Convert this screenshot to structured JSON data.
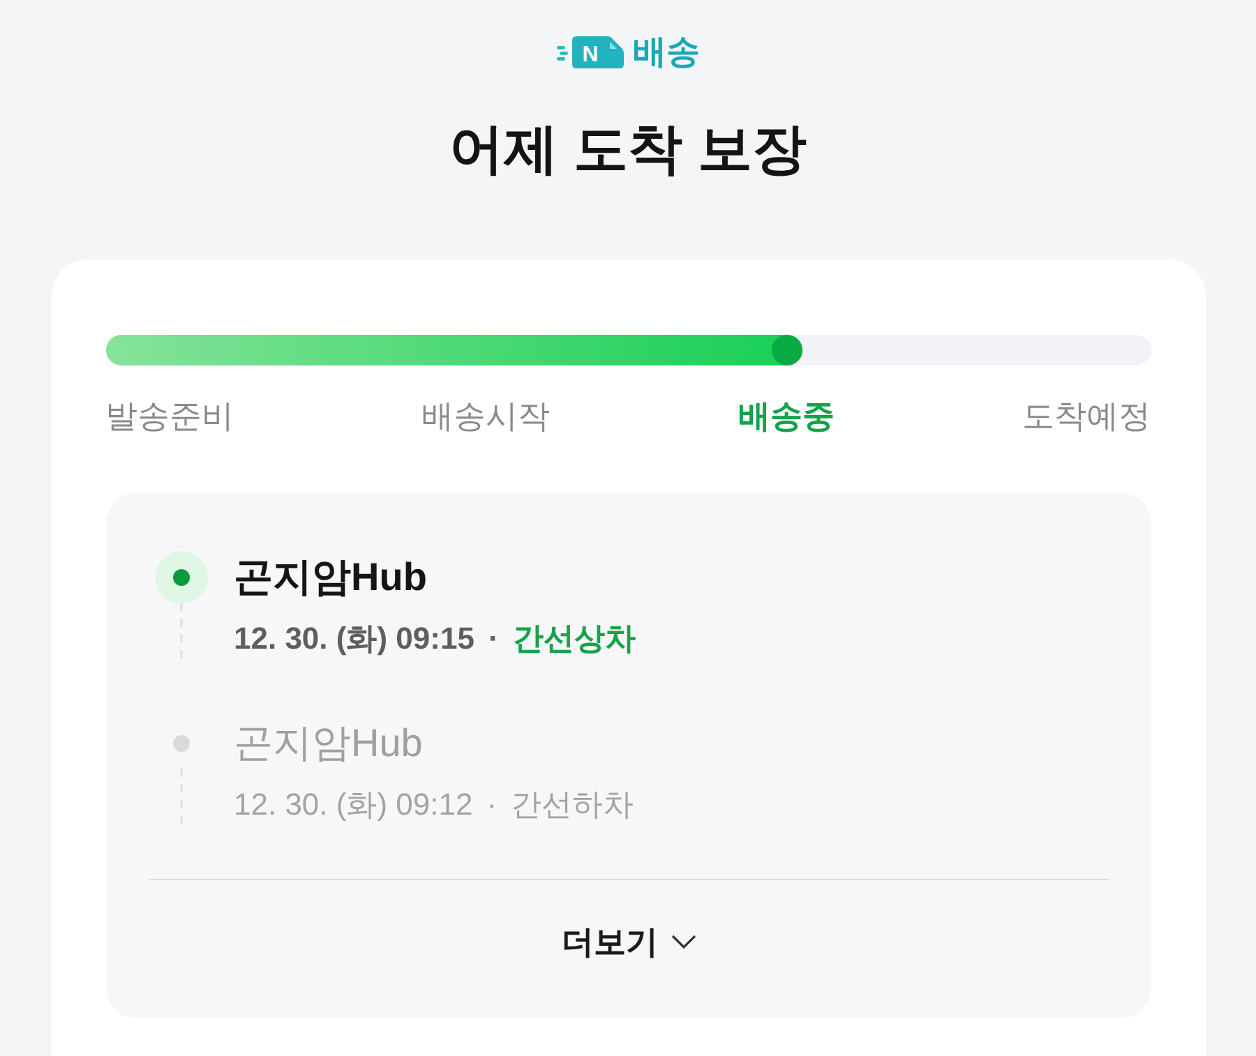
{
  "logo": {
    "mark": "N",
    "label": "배송"
  },
  "title": "어제 도착 보장",
  "progress": {
    "level": 0.667,
    "stages": [
      {
        "label": "발송준비",
        "selected": false
      },
      {
        "label": "배송시작",
        "selected": false
      },
      {
        "label": "배송중",
        "selected": true
      },
      {
        "label": "도착예정",
        "selected": false
      }
    ]
  },
  "timeline": {
    "events": [
      {
        "location": "곤지암Hub",
        "time": "12. 30. (화) 09:15",
        "separator": "·",
        "status": "간선상차",
        "current": true
      },
      {
        "location": "곤지암Hub",
        "time": "12. 30. (화) 09:12",
        "separator": "·",
        "status": "간선하차",
        "current": false
      }
    ],
    "more_button": {
      "label": "더보기"
    }
  }
}
